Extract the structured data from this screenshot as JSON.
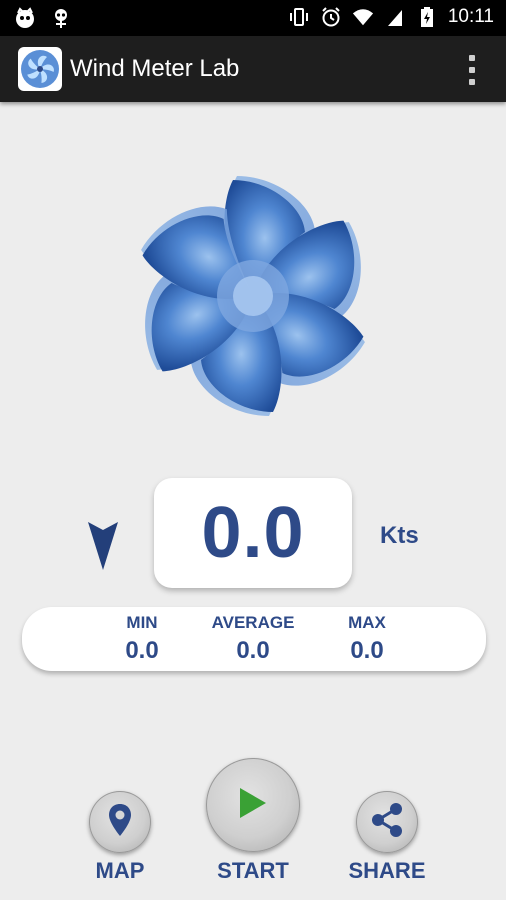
{
  "status_bar": {
    "time": "10:11",
    "left_icons": [
      "cat-face-icon",
      "antenna-icon"
    ],
    "right_icons": [
      "vibrate-icon",
      "alarm-icon",
      "wifi-icon",
      "signal-icon",
      "battery-charging-icon"
    ]
  },
  "app": {
    "title": "Wind Meter Lab",
    "logo_icon": "fan-icon",
    "menu_icon": "overflow-menu-icon"
  },
  "reading": {
    "direction_icon": "direction-arrow-icon",
    "speed": "0.0",
    "unit": "Kts"
  },
  "stats": {
    "min_label": "MIN",
    "min_value": "0.0",
    "average_label": "AVERAGE",
    "average_value": "0.0",
    "max_label": "MAX",
    "max_value": "0.0"
  },
  "buttons": {
    "map_label": "MAP",
    "start_label": "START",
    "share_label": "SHARE"
  },
  "colors": {
    "accent": "#2e4a88",
    "fan_blue": "#3a6fc0",
    "play_green": "#3aa135",
    "background": "#ededed"
  }
}
